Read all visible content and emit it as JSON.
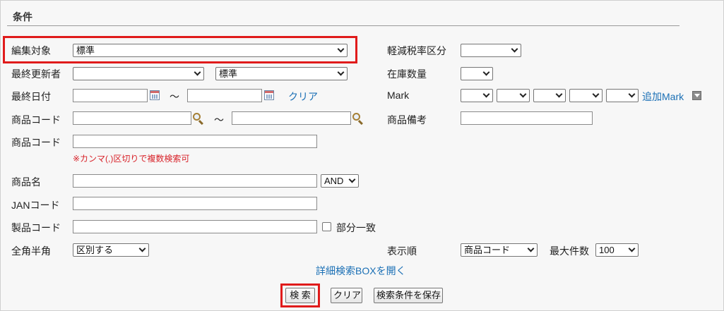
{
  "section": {
    "title": "条件"
  },
  "edit_target": {
    "label": "編集対象",
    "value": "標準"
  },
  "last_updater": {
    "label": "最終更新者",
    "value": "",
    "value2": "標準"
  },
  "last_date": {
    "label": "最終日付",
    "from": "",
    "to": "",
    "tilde": "〜",
    "clear": "クリア"
  },
  "product_code_range": {
    "label": "商品コード",
    "from": "",
    "to": "",
    "tilde": "〜"
  },
  "product_code_multi": {
    "label": "商品コード",
    "value": "",
    "note": "※カンマ(,)区切りで複数検索可"
  },
  "product_name": {
    "label": "商品名",
    "value": "",
    "mode": "AND"
  },
  "jan_code": {
    "label": "JANコード",
    "value": ""
  },
  "maker_code": {
    "label": "製品コード",
    "value": "",
    "partial": "部分一致"
  },
  "width_mode": {
    "label": "全角半角",
    "value": "区別する"
  },
  "tax_rate": {
    "label": "軽減税率区分",
    "value": ""
  },
  "stock": {
    "label": "在庫数量",
    "value": ""
  },
  "mark": {
    "label": "Mark",
    "values": [
      "",
      "",
      "",
      "",
      ""
    ],
    "add": "追加Mark"
  },
  "product_note": {
    "label": "商品備考",
    "value": ""
  },
  "sort": {
    "label": "表示順",
    "value": "商品コード"
  },
  "max_count": {
    "label": "最大件数",
    "value": "100"
  },
  "detail_link": "詳細検索BOXを開く",
  "buttons": {
    "search": "検 索",
    "clear": "クリア",
    "save": "検索条件を保存"
  },
  "colors": {
    "highlight": "#e01b1b",
    "link": "#1a6fb5",
    "note": "#d8232a"
  }
}
